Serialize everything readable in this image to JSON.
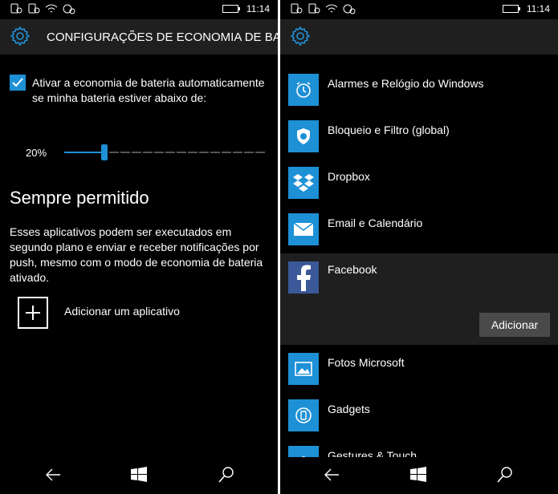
{
  "status": {
    "time": "11:14"
  },
  "left": {
    "header_title": "CONFIGURAÇÕES DE ECONOMIA DE BATE",
    "checkbox_label": "Ativar a economia de bateria automaticamente se minha bateria estiver abaixo de:",
    "checkbox_checked": true,
    "threshold_label": "20%",
    "threshold_value": 0.2,
    "section_title": "Sempre permitido",
    "section_desc": "Esses aplicativos podem ser executados em segundo plano e enviar e receber notificações por push, mesmo com o modo de economia de bateria ativado.",
    "add_app_label": "Adicionar um aplicativo"
  },
  "right": {
    "apps": [
      {
        "name": "Alarmes e Relógio do Windows",
        "icon": "alarm-clock-icon"
      },
      {
        "name": "Bloqueio e Filtro (global)",
        "icon": "shield-icon"
      },
      {
        "name": "Dropbox",
        "icon": "dropbox-icon"
      },
      {
        "name": "Email e Calendário",
        "icon": "mail-icon"
      },
      {
        "name": "Facebook",
        "icon": "facebook-icon",
        "selected": true
      },
      {
        "name": "Fotos Microsoft",
        "icon": "photos-icon"
      },
      {
        "name": "Gadgets",
        "icon": "gadgets-icon"
      },
      {
        "name": "Gestures & Touch",
        "icon": "gestures-icon"
      }
    ],
    "add_button_label": "Adicionar"
  },
  "colors": {
    "accent": "#1e90d6",
    "background": "#000000",
    "header": "#1f1f1f",
    "facebook": "#3b5998"
  }
}
